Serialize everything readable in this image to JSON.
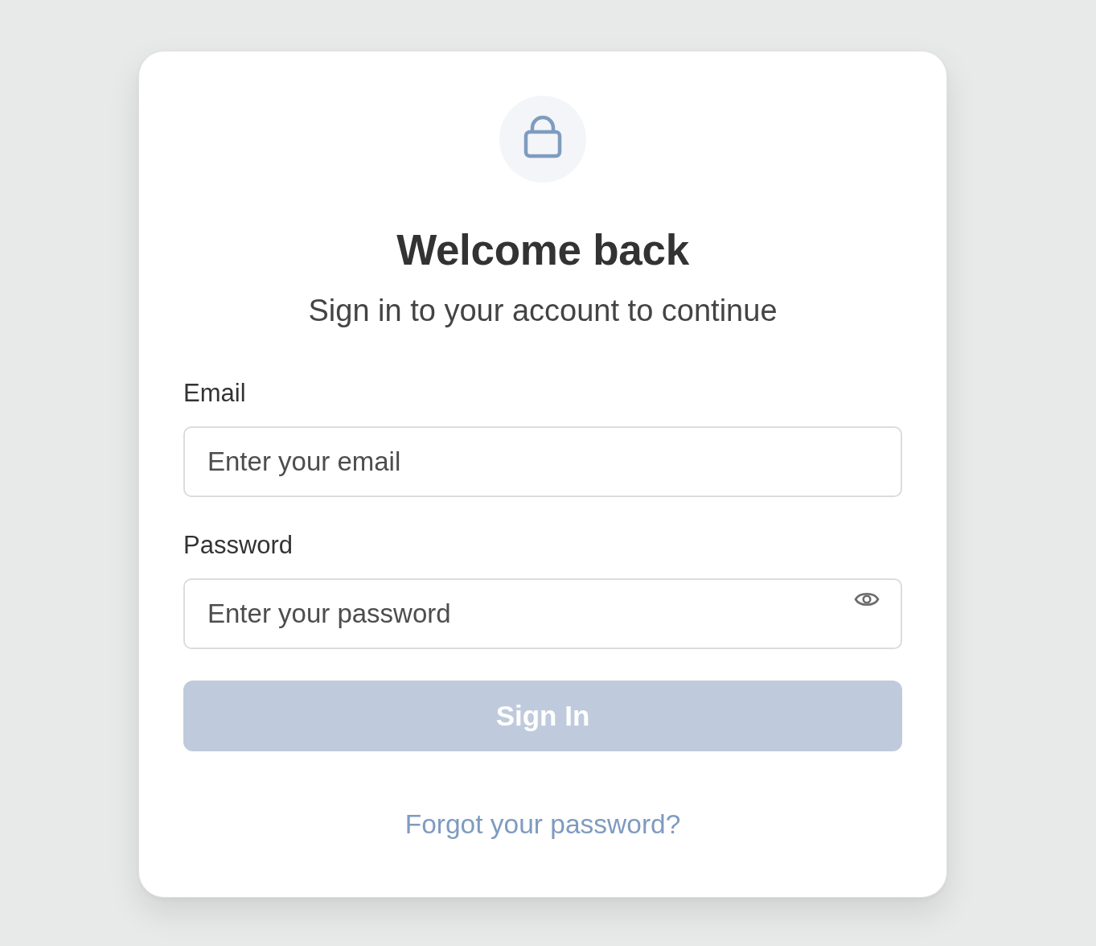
{
  "header": {
    "title": "Welcome back",
    "subtitle": "Sign in to your account to continue"
  },
  "fields": [
    {
      "label": "Email",
      "placeholder": "Enter your email",
      "reveal_toggle": false
    },
    {
      "label": "Password",
      "placeholder": "Enter your password",
      "reveal_toggle": true
    }
  ],
  "submit": {
    "label": "Sign In",
    "disabled": true
  },
  "forgot_link": {
    "label": "Forgot your password?"
  }
}
